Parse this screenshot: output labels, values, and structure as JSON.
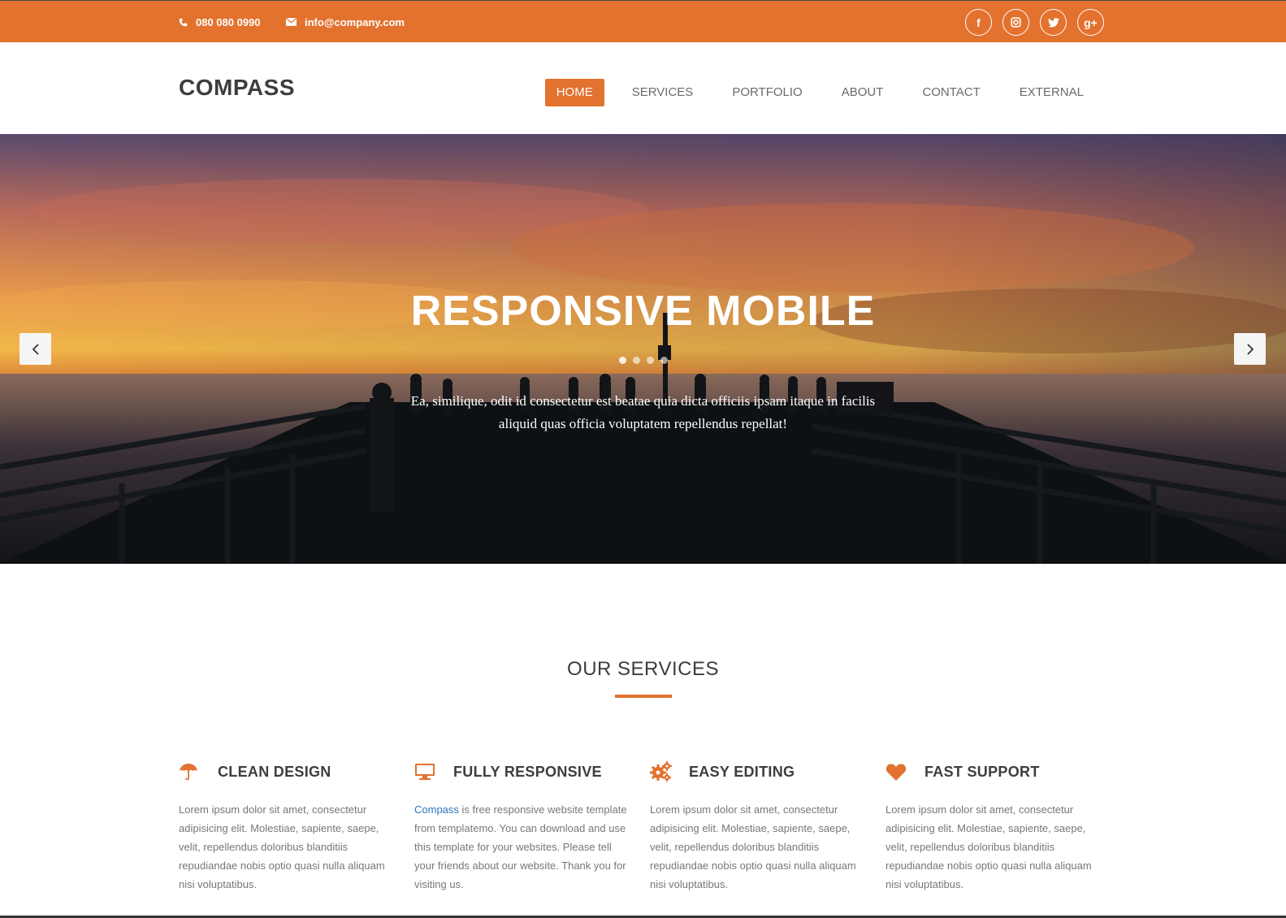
{
  "topbar": {
    "phone": "080 080 0990",
    "email": "info@company.com",
    "social": [
      {
        "icon": "facebook-icon",
        "glyph": "f"
      },
      {
        "icon": "instagram-icon",
        "glyph": "◙"
      },
      {
        "icon": "twitter-icon",
        "glyph": "t"
      },
      {
        "icon": "google-plus-icon",
        "glyph": "g+"
      }
    ]
  },
  "header": {
    "logo": "COMPASS",
    "nav": [
      "HOME",
      "SERVICES",
      "PORTFOLIO",
      "ABOUT",
      "CONTACT",
      "EXTERNAL"
    ],
    "active_nav": "HOME"
  },
  "hero": {
    "title": "RESPONSIVE MOBILE",
    "text": "Ea, similique, odit id consectetur est beatae quia dicta officiis ipsam itaque in facilis aliquid quas officia voluptatem repellendus repellat!",
    "slide_count": 4,
    "active_slide": 1,
    "prev_icon": "chevron-left-icon",
    "next_icon": "chevron-right-icon"
  },
  "services": {
    "heading": "OUR SERVICES",
    "items": [
      {
        "icon": "umbrella-icon",
        "title": "CLEAN DESIGN",
        "description": "Lorem ipsum dolor sit amet, consectetur adipisicing elit. Molestiae, sapiente, saepe, velit, repellendus doloribus blanditiis repudiandae nobis optio quasi nulla aliquam nisi voluptatibus."
      },
      {
        "icon": "desktop-icon",
        "title": "FULLY RESPONSIVE",
        "link_text": "Compass",
        "description": " is free responsive website template from templatemo. You can download and use this template for your websites. Please tell your friends about our website. Thank you for visiting us."
      },
      {
        "icon": "gears-icon",
        "title": "EASY EDITING",
        "description": "Lorem ipsum dolor sit amet, consectetur adipisicing elit. Molestiae, sapiente, saepe, velit, repellendus doloribus blanditiis repudiandae nobis optio quasi nulla aliquam nisi voluptatibus."
      },
      {
        "icon": "heart-icon",
        "title": "FAST SUPPORT",
        "description": "Lorem ipsum dolor sit amet, consectetur adipisicing elit. Molestiae, sapiente, saepe, velit, repellendus doloribus blanditiis repudiandae nobis optio quasi nulla aliquam nisi voluptatibus."
      }
    ]
  },
  "colors": {
    "accent": "#e2722e",
    "heading": "#3d3d3d",
    "body_text": "#777777",
    "link": "#2e75b8"
  }
}
